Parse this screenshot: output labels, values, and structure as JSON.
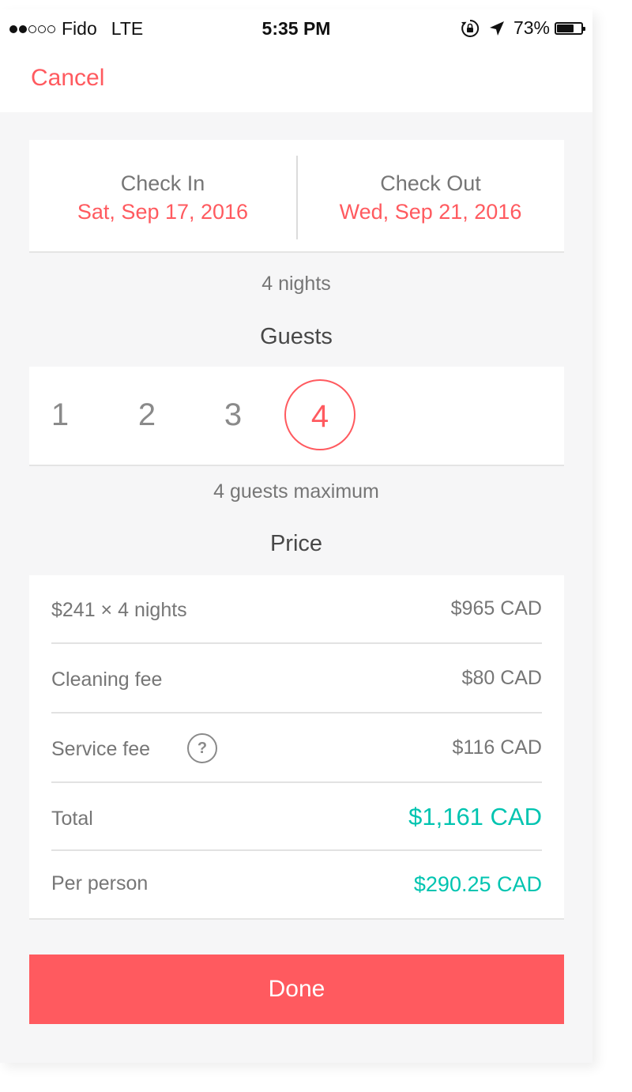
{
  "status_bar": {
    "signal_filled": 2,
    "signal_total": 5,
    "carrier": "Fido",
    "network": "LTE",
    "time": "5:35 PM",
    "battery_percent": "73%",
    "battery_level": 0.73,
    "icons": [
      "orientation-lock-icon",
      "location-arrow-icon",
      "battery-icon"
    ]
  },
  "nav": {
    "cancel_label": "Cancel"
  },
  "dates": {
    "check_in_label": "Check In",
    "check_in_value": "Sat, Sep 17, 2016",
    "check_out_label": "Check Out",
    "check_out_value": "Wed, Sep 21, 2016"
  },
  "nights_text": "4 nights",
  "guests": {
    "heading": "Guests",
    "options": [
      "1",
      "2",
      "3",
      "4"
    ],
    "selected": "4",
    "max_text": "4 guests maximum"
  },
  "price": {
    "heading": "Price",
    "rows": [
      {
        "label": "$241 × 4 nights",
        "value": "$965 CAD"
      },
      {
        "label": "Cleaning fee",
        "value": "$80 CAD"
      },
      {
        "label": "Service fee",
        "value": "$116 CAD",
        "help": "?"
      },
      {
        "label": "Total",
        "value": "$1,161 CAD"
      },
      {
        "label": "Per person",
        "value": "$290.25 CAD"
      }
    ]
  },
  "colors": {
    "accent": "#ff5a5f",
    "teal": "#00c4b0",
    "text_muted": "#767676",
    "text_dark": "#484848"
  },
  "done_label": "Done"
}
